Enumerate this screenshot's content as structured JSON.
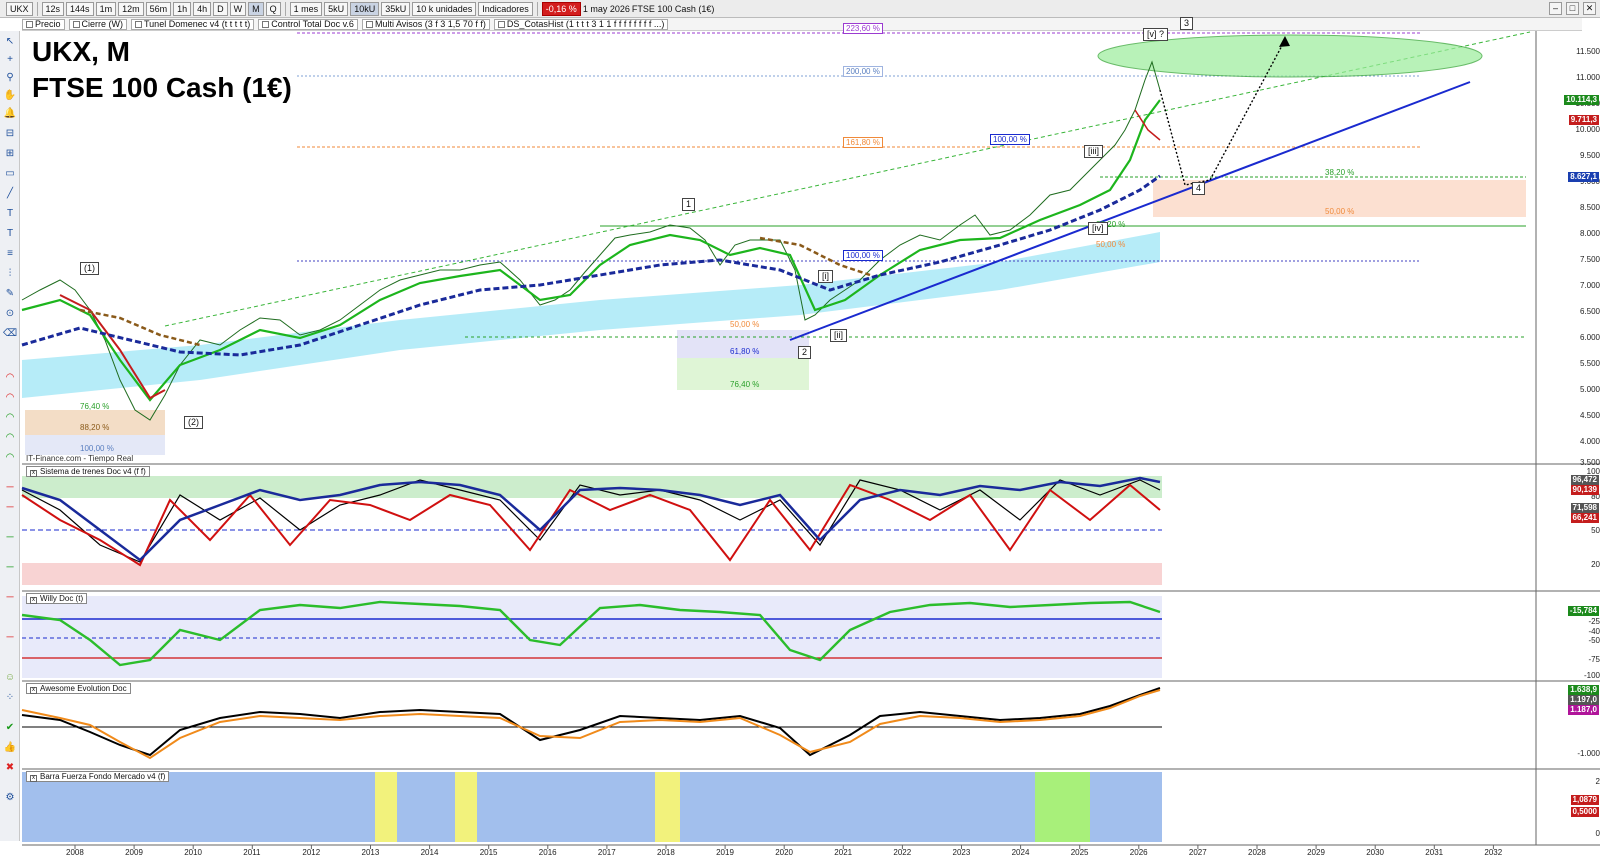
{
  "toolbar": {
    "symbol": "UKX",
    "intervals": [
      "12s",
      "144s",
      "1m",
      "12m",
      "56m",
      "1h",
      "4h",
      "D",
      "W",
      "M",
      "Q"
    ],
    "active_interval": "M",
    "period": "1 mes",
    "ticks": [
      "5kU",
      "10kU",
      "35kU"
    ],
    "active_tick": "10kU",
    "units": "10 k unidades",
    "indicators": "Indicadores",
    "change": "-0,16 %",
    "date": "1 may 2026",
    "instrument": "FTSE 100 Cash (1€)"
  },
  "studies": [
    "Precio",
    "Cierre (W)",
    "Tunel Domenec v4 (t t t t t)",
    "Control Total Doc v.6",
    "Multi Avisos (3 f 3 1,5 70 f f)",
    "DS_CotasHist (1 t t t 3 1 1 f f f f f f f f ...)"
  ],
  "chart": {
    "title_line1": "UKX, M",
    "title_line2": "FTSE 100 Cash (1€)",
    "source": "IT-Finance.com - Tiempo Real",
    "price_axis": [
      "11.500",
      "11.000",
      "10.500",
      "10.000",
      "9.500",
      "9.000",
      "8.500",
      "8.000",
      "7.500",
      "7.000",
      "6.500",
      "6.000",
      "5.500",
      "5.000",
      "4.500",
      "4.000",
      "3.500"
    ],
    "badges": [
      {
        "label": "10.114,3",
        "color": "#1c8a1c"
      },
      {
        "label": "9.711,3",
        "color": "#c41d1d"
      },
      {
        "label": "8.627,1",
        "color": "#1a3fb0"
      }
    ],
    "fibs": [
      "223,60 %",
      "200,00 %",
      "161,80 %",
      "100,00 %",
      "38,20 %",
      "50,00 %",
      "100,00 %",
      "50,00 %",
      "61,80 %",
      "76,40 %",
      "76,40 %",
      "88,20 %",
      "100,00 %",
      "50,00 %",
      "38,20 %"
    ],
    "waves": [
      "(1)",
      "(2)",
      "1",
      "2",
      "3",
      "4",
      "[i]",
      "[ii]",
      "[iii]",
      "[iv]",
      "[v] ?"
    ],
    "years": [
      "2008",
      "2009",
      "2010",
      "2011",
      "2012",
      "2013",
      "2014",
      "2015",
      "2016",
      "2017",
      "2018",
      "2019",
      "2020",
      "2021",
      "2022",
      "2023",
      "2024",
      "2025",
      "2026",
      "2027",
      "2028",
      "2029",
      "2030",
      "2031",
      "2032"
    ]
  },
  "panels": {
    "p1": {
      "title": "Sistema de trenes Doc v4 (f f)",
      "axis": [
        "100",
        "80",
        "50",
        "20"
      ],
      "values": [
        "96,472",
        "90,139",
        "71,598",
        "66,241"
      ]
    },
    "p2": {
      "title": "Willy Doc (t)",
      "axis": [
        "-25",
        "-40",
        "-50",
        "-75",
        "-100"
      ],
      "values": [
        "-15,784"
      ]
    },
    "p3": {
      "title": "Awesome Evolution Doc",
      "axis": [
        "-1.000"
      ],
      "values": [
        "1.638,9",
        "1.197,0",
        "1.187,0"
      ]
    },
    "p4": {
      "title": "Barra Fuerza Fondo Mercado v4 (f)",
      "axis": [
        "2",
        "0"
      ],
      "values": [
        "1,0879",
        "0,5000"
      ]
    }
  },
  "colors": {
    "up": "#2aa02a",
    "down": "#d01010",
    "blue": "#1a2a9a",
    "cyan": "#74d3ee",
    "green_ellipse": "#86e886"
  }
}
